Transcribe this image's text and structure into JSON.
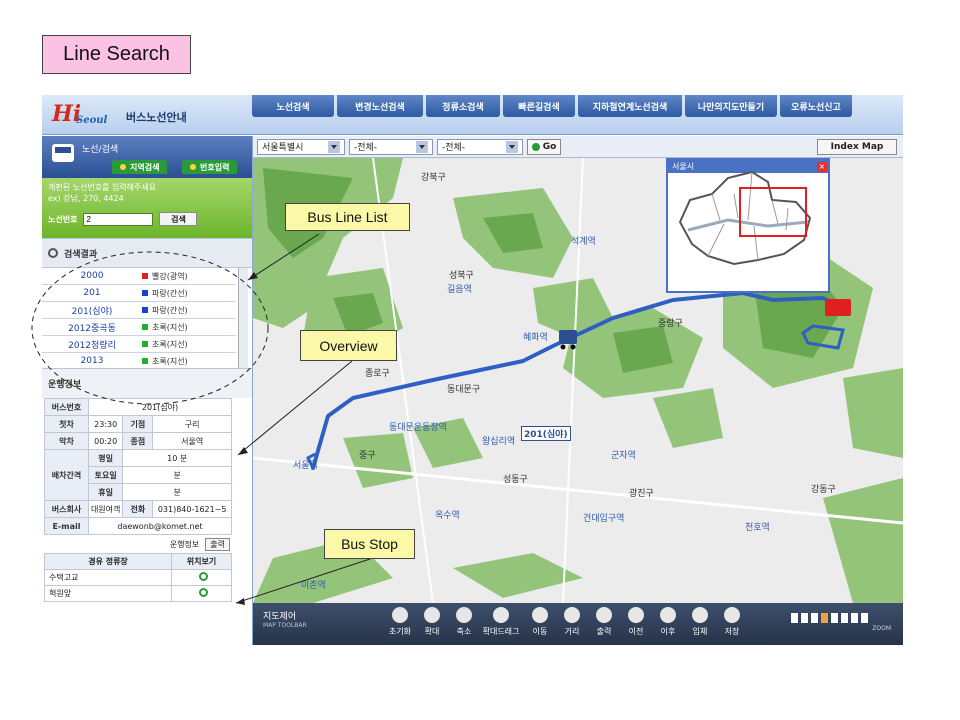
{
  "slide_title": "Line Search",
  "callouts": {
    "bus_line_list": "Bus Line List",
    "overview": "Overview",
    "bus_stop": "Bus Stop"
  },
  "header": {
    "logo_hi": "Hi",
    "logo_seoul": "Seoul",
    "app_title": "버스노선안내",
    "nav": [
      "노선검색",
      "변경노선검색",
      "정류소검색",
      "빠른길검색",
      "지하철연계노선검색",
      "나만의지도만들기",
      "오류노선신고"
    ]
  },
  "search": {
    "title": "노선/검색",
    "tab_area": "지역검색",
    "tab_number": "번호입력",
    "hint1": "개편된 노선번호를 입력해주세요",
    "hint2": "ex) 강남, 270, 4424",
    "field_label": "노선번호",
    "field_value": "2",
    "button": "검색"
  },
  "results": {
    "title": "검색결과",
    "rows": [
      {
        "number": "2000",
        "type": "빨강(광역)",
        "color": "#e02020"
      },
      {
        "number": "201",
        "type": "파랑(간선)",
        "color": "#1a3fd8"
      },
      {
        "number": "201(심야)",
        "type": "파랑(간선)",
        "color": "#1a3fd8"
      },
      {
        "number": "2012중곡동",
        "type": "초록(지선)",
        "color": "#20b030"
      },
      {
        "number": "2012청량리",
        "type": "초록(지선)",
        "color": "#20b030"
      },
      {
        "number": "2013",
        "type": "초록(지선)",
        "color": "#20b030"
      }
    ]
  },
  "operation": {
    "title": "운행정보",
    "bus_no_label": "버스번호",
    "bus_no": "201(심야)",
    "first_label": "첫차",
    "first": "23:30",
    "origin_label": "기점",
    "origin": "구리",
    "last_label": "막차",
    "last": "00:20",
    "terminus_label": "종점",
    "terminus": "서울역",
    "interval_label": "배차간격",
    "weekday_label": "평일",
    "weekday": "10 분",
    "saturday_label": "토요일",
    "saturday": "분",
    "holiday_label": "휴일",
    "holiday": "분",
    "company_label": "버스회사",
    "company": "대원여객",
    "phone_label": "전화",
    "phone": "031)840-1621~5",
    "email_label": "E-mail",
    "email": "daewonb@komet.net",
    "print_info": "운행정보",
    "print_btn": "출력"
  },
  "stops": {
    "col_stop": "경유 정류장",
    "col_loc": "위치보기",
    "items": [
      "수택고교",
      "혁원앞"
    ]
  },
  "map_toolbar": {
    "city": "서울특별시",
    "district": "-전체-",
    "dong": "-전체-",
    "go": "Go",
    "index_map": "Index Map"
  },
  "minimap": {
    "title": "서울시",
    "close": "×"
  },
  "bus_label": "201(심야)",
  "places": [
    "강북구",
    "석계역",
    "성북구",
    "길음역",
    "중랑구",
    "혜화역",
    "종로구",
    "동대문구",
    "동대문운동장역",
    "왕십리역",
    "중구",
    "서울역",
    "군자역",
    "성동구",
    "광진구",
    "옥수역",
    "건대입구역",
    "강동구",
    "천호역",
    "이촌역"
  ],
  "map_control": {
    "title": "지도제어",
    "subtitle": "MAP TOOLBAR",
    "buttons": [
      "초기화",
      "확대",
      "축소",
      "확대드래그",
      "이동",
      "거리",
      "출력",
      "이전",
      "이후",
      "입체",
      "저장"
    ],
    "zoom_label": "ZOOM"
  }
}
